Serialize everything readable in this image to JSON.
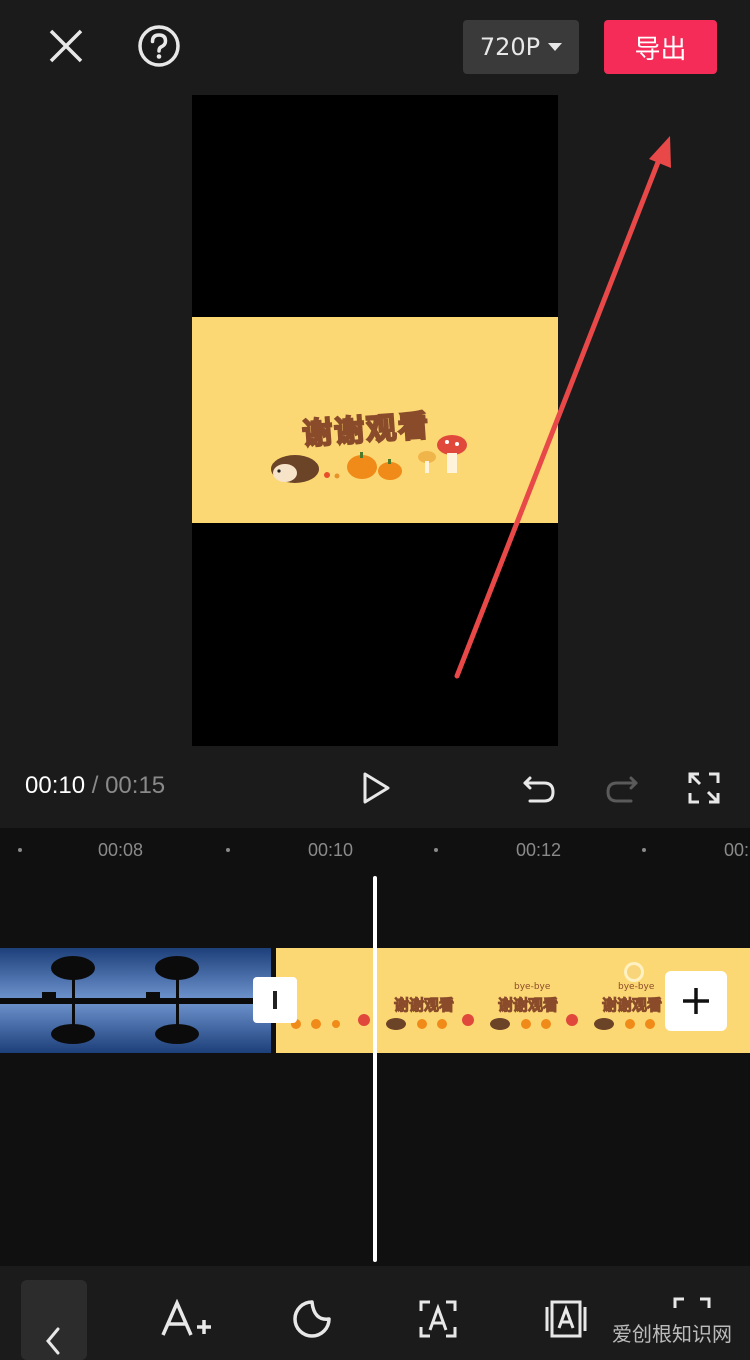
{
  "top_bar": {
    "resolution_label": "720P",
    "export_label": "导出"
  },
  "preview": {
    "overlay_title": "谢谢观看",
    "band_color": "#fcd874"
  },
  "playback": {
    "current_time": "00:10",
    "separator": "/",
    "total_time": "00:15"
  },
  "timeline": {
    "ruler_labels": [
      "00:08",
      "00:10",
      "00:12",
      "00:1"
    ],
    "clip_b_caption": "谢谢观看",
    "clip_b_tag": "bye-bye"
  },
  "toolbar": {
    "items": [
      "back",
      "add-text",
      "sticker",
      "text-template",
      "auto-caption",
      "more"
    ]
  },
  "watermark": "爱创根知识网",
  "colors": {
    "accent": "#f52b58",
    "annotation_arrow": "#e84848"
  }
}
